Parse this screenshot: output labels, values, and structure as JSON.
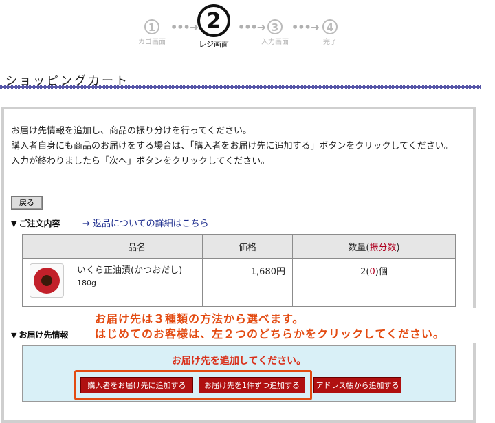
{
  "steps": {
    "s1": {
      "num": "1",
      "label": "カゴ画面"
    },
    "s2": {
      "num": "2",
      "label": "レジ画面"
    },
    "s3": {
      "num": "3",
      "label": "入力画面"
    },
    "s4": {
      "num": "4",
      "label": "完了"
    },
    "arrow": "•••➜"
  },
  "page_title": "ショッピングカート",
  "intro": {
    "line1": "お届け先情報を追加し、商品の振り分けを行ってください。",
    "line2": "購入者自身にも商品のお届けをする場合は、「購入者をお届け先に追加する」ボタンをクリックしてください。",
    "line3": "入力が終わりましたら「次へ」ボタンをクリックしてください。"
  },
  "back_button": "戻る",
  "order": {
    "heading": "ご注文内容",
    "return_link": "→ 返品についての詳細はこちら",
    "columns": {
      "name": "品名",
      "price": "価格",
      "qty": "数量(",
      "qty_link": "振分数",
      "qty_close": ")"
    },
    "item": {
      "name": "いくら正油漬(かつおだし)",
      "weight": "180g",
      "price": "1,680円",
      "qty": "2",
      "alloc": "0",
      "unit": "個"
    }
  },
  "delivery": {
    "heading": "お届け先情報",
    "message": "お届け先を追加してください。",
    "buttons": {
      "b1": "購入者をお届け先に追加する",
      "b2": "お届け先を1件ずつ追加する",
      "b3": "アドレス帳から追加する"
    }
  },
  "annotation": {
    "line1": "お届け先は３種類の方法から選べます。",
    "line2": "はじめてのお客様は、左２つのどちらかをクリックしてください。"
  },
  "colors": {
    "accent_orange": "#e34b12",
    "button_red": "#b01010",
    "delivery_bg": "#d9f0f7",
    "link_blue": "#1a2a8c"
  }
}
